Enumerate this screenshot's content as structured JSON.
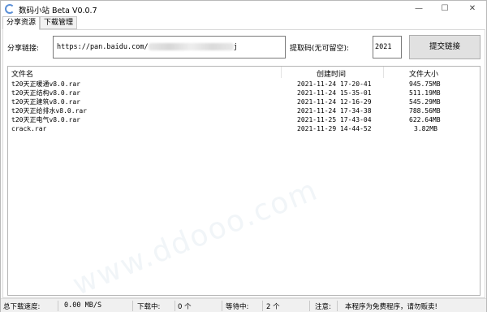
{
  "window": {
    "title": "数码小站 Beta V0.0.7",
    "minimize": "—",
    "maximize": "☐",
    "close": "✕"
  },
  "tabs": [
    "分享资源",
    "下载管理"
  ],
  "share": {
    "link_label": "分享链接:",
    "link_value": "https://pan.baidu.com/",
    "link_suffix": "j",
    "code_label": "提取码(无可留空):",
    "code_value": "2021",
    "submit_label": "提交链接"
  },
  "list": {
    "columns": [
      "文件名",
      "创建时间",
      "文件大小"
    ],
    "rows": [
      {
        "name": "t20天正暖通v8.0.rar",
        "time": "2021-11-24 17-20-41",
        "size": "945.75MB"
      },
      {
        "name": "t20天正结构v8.0.rar",
        "time": "2021-11-24 15-35-01",
        "size": "511.19MB"
      },
      {
        "name": "t20天正建筑v8.0.rar",
        "time": "2021-11-24 12-16-29",
        "size": "545.29MB"
      },
      {
        "name": "t20天正给排水v8.0.rar",
        "time": "2021-11-24 17-34-38",
        "size": "788.56MB"
      },
      {
        "name": "t20天正电气v8.0.rar",
        "time": "2021-11-25 17-43-04",
        "size": "622.64MB"
      },
      {
        "name": "crack.rar",
        "time": "2021-11-29 14-44-52",
        "size": "3.82MB"
      }
    ]
  },
  "status": {
    "speed_label": "总下载速度:",
    "speed_value": "0.00 MB/S",
    "downloading_label": "下载中:",
    "downloading_value": "0 个",
    "waiting_label": "等待中:",
    "waiting_value": "2 个",
    "note_label": "注意:",
    "note_value": "本程序为免费程序，请勿贩卖!"
  },
  "colors": {
    "accent": "#5b8fd6",
    "button_bg": "#e1e1e1",
    "statusbar_bg": "#f0f0f0"
  }
}
